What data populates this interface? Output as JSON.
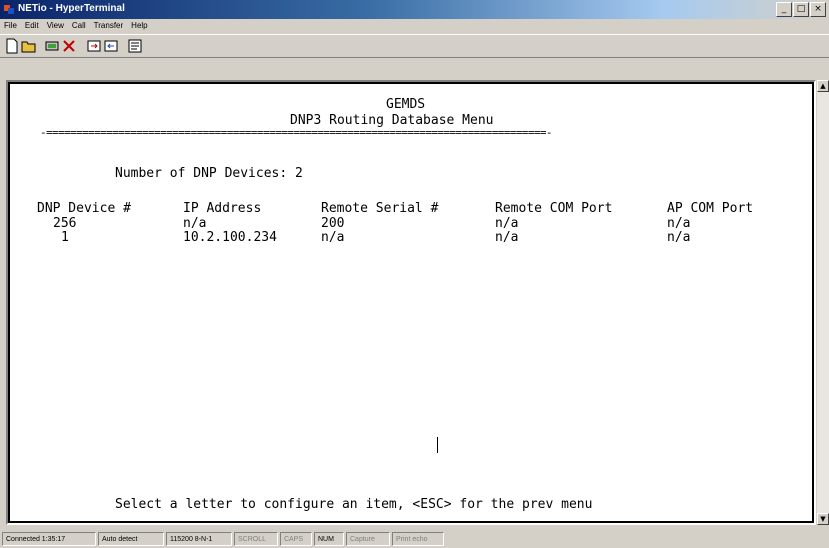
{
  "window": {
    "title": "NETio - HyperTerminal"
  },
  "menu": [
    "File",
    "Edit",
    "View",
    "Call",
    "Transfer",
    "Help"
  ],
  "toolbar": [
    "new-icon",
    "open-icon",
    "connect-icon",
    "disconnect-icon",
    "send-icon",
    "receive-icon",
    "properties-icon"
  ],
  "terminal": {
    "header1": "GEMDS",
    "header2": "DNP3 Routing Database Menu",
    "separator": "-===================================================================================-",
    "device_count_label": "Number of DNP Devices: 2",
    "columns": [
      "DNP Device #",
      "IP Address",
      "Remote Serial #",
      "Remote COM Port",
      "AP COM Port"
    ],
    "rows": [
      [
        "256",
        "n/a",
        "200",
        "n/a",
        "n/a"
      ],
      [
        "1",
        "10.2.100.234",
        "n/a",
        "n/a",
        "n/a"
      ]
    ],
    "footer": "Select a letter to configure an item, <ESC> for the prev menu"
  },
  "status": {
    "connected": "Connected 1:35:17",
    "detect": "Auto detect",
    "settings": "115200 8-N-1",
    "scroll": "SCROLL",
    "caps": "CAPS",
    "num": "NUM",
    "capture": "Capture",
    "echo": "Print echo"
  },
  "colors": {
    "titlebar_start": "#0a246a",
    "terminal_bg": "#ffffff",
    "chrome": "#d4d0c8"
  }
}
